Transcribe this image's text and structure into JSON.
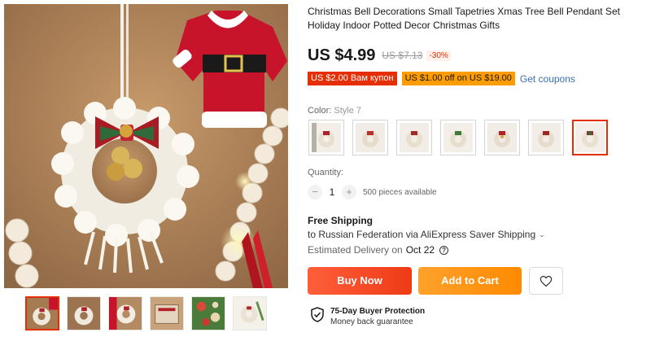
{
  "product": {
    "title": "Christmas Bell Decorations Small Tapetries Xmas Tree Bell Pendant Set Holiday Indoor Potted Decor Christmas Gifts",
    "price": "US $4.99",
    "old_price": "US $7.13",
    "discount": "-30%"
  },
  "coupons": {
    "coupon1": "US $2.00 Вам купон",
    "coupon2": "US $1.00 off on US $19.00",
    "get_coupons": "Get coupons"
  },
  "color": {
    "label": "Color: ",
    "selected": "Style 7",
    "options_count": 7,
    "selected_index": 6
  },
  "quantity": {
    "label": "Quantity:",
    "value": "1",
    "minus": "−",
    "plus": "+",
    "available": "500 pieces available"
  },
  "shipping": {
    "title": "Free Shipping",
    "to": "to Russian Federation via AliExpress Saver Shipping",
    "chevron": "⌄",
    "delivery_label": "Estimated Delivery on",
    "delivery_date": "Oct 22",
    "help": "?"
  },
  "actions": {
    "buy_now": "Buy Now",
    "add_to_cart": "Add to Cart",
    "wishlist_icon": "heart-outline-icon"
  },
  "protection": {
    "title": "75-Day Buyer Protection",
    "subtitle": "Money back guarantee",
    "icon": "shield-check-icon"
  },
  "gallery": {
    "thumb_count": 6,
    "active_index": 0
  },
  "colors": {
    "accent_red": "#e62e04",
    "accent_orange": "#ff9c00",
    "link_blue": "#3a6fb0"
  }
}
